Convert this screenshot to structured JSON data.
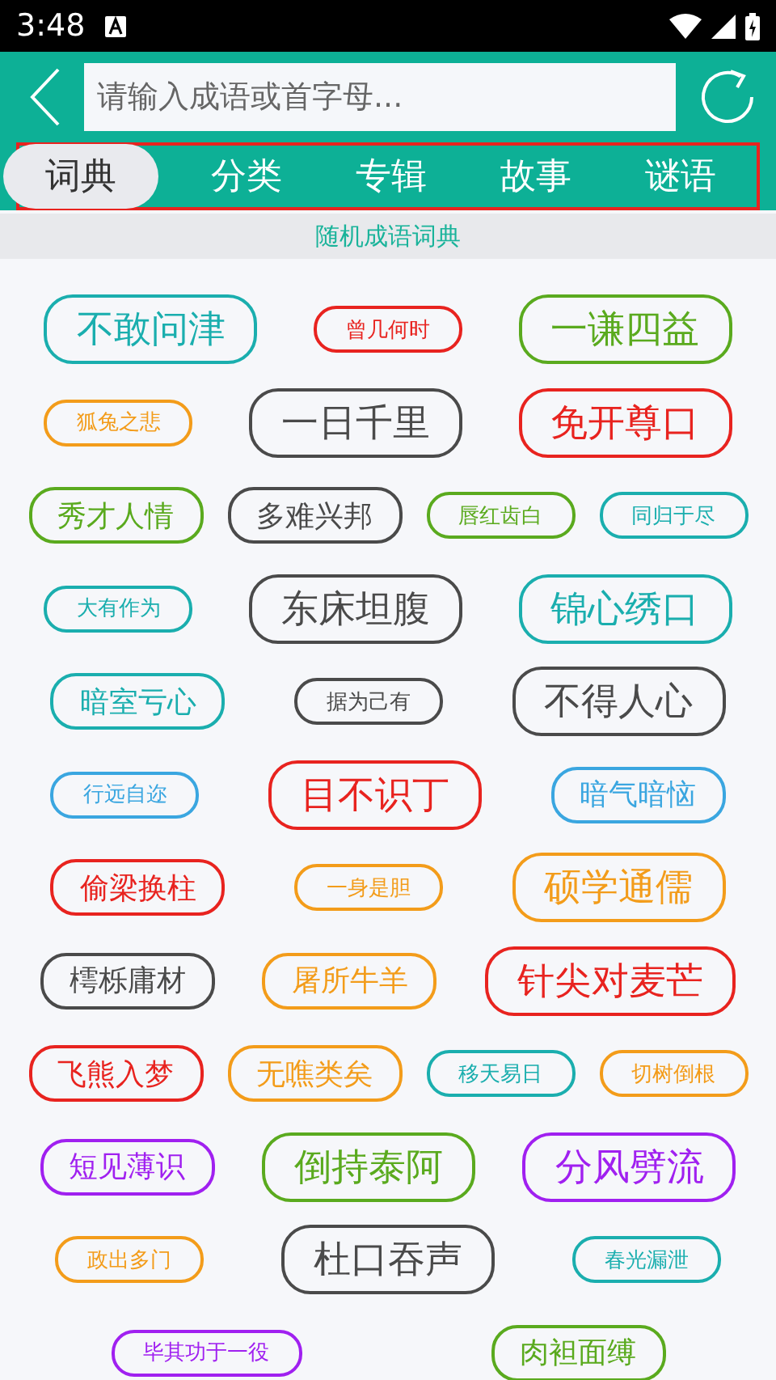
{
  "status_bar": {
    "time": "3:48"
  },
  "search": {
    "placeholder": "请输入成语或首字母..."
  },
  "tabs": [
    {
      "label": "词典",
      "selected": true
    },
    {
      "label": "分类",
      "selected": false
    },
    {
      "label": "专辑",
      "selected": false
    },
    {
      "label": "故事",
      "selected": false
    },
    {
      "label": "谜语",
      "selected": false
    }
  ],
  "section_title": "随机成语词典",
  "tag_rows": [
    [
      {
        "text": "不敢问津",
        "kind": "large",
        "color": "#1aaeae"
      },
      {
        "text": "曾几何时",
        "kind": "small",
        "color": "#e8231f"
      },
      {
        "text": "一谦四益",
        "kind": "large",
        "color": "#5aaa1e"
      }
    ],
    [
      {
        "text": "狐兔之悲",
        "kind": "small",
        "color": "#f39c1a"
      },
      {
        "text": "一日千里",
        "kind": "large",
        "color": "#4a4a4a"
      },
      {
        "text": "免开尊口",
        "kind": "large",
        "color": "#e8231f"
      }
    ],
    [
      {
        "text": "秀才人情",
        "kind": "medium",
        "color": "#5aaa1e"
      },
      {
        "text": "多难兴邦",
        "kind": "medium",
        "color": "#4a4a4a"
      },
      {
        "text": "唇红齿白",
        "kind": "small",
        "color": "#5aaa1e"
      },
      {
        "text": "同归于尽",
        "kind": "small",
        "color": "#1aaeae"
      }
    ],
    [
      {
        "text": "大有作为",
        "kind": "small",
        "color": "#1aaeae"
      },
      {
        "text": "东床坦腹",
        "kind": "large",
        "color": "#4a4a4a"
      },
      {
        "text": "锦心绣口",
        "kind": "large",
        "color": "#1aaeae"
      }
    ],
    [
      {
        "text": "暗室亏心",
        "kind": "medium",
        "color": "#1aaeae"
      },
      {
        "text": "据为己有",
        "kind": "small",
        "color": "#4a4a4a"
      },
      {
        "text": "不得人心",
        "kind": "large",
        "color": "#4a4a4a"
      }
    ],
    [
      {
        "text": "行远自迩",
        "kind": "small",
        "color": "#3aa6e0"
      },
      {
        "text": "目不识丁",
        "kind": "large",
        "color": "#e8231f"
      },
      {
        "text": "暗气暗恼",
        "kind": "medium",
        "color": "#3aa6e0"
      }
    ],
    [
      {
        "text": "偷梁换柱",
        "kind": "medium",
        "color": "#e8231f"
      },
      {
        "text": "一身是胆",
        "kind": "small",
        "color": "#f39c1a"
      },
      {
        "text": "硕学通儒",
        "kind": "large",
        "color": "#f39c1a"
      }
    ],
    [
      {
        "text": "樗栎庸材",
        "kind": "medium",
        "color": "#4a4a4a"
      },
      {
        "text": "屠所牛羊",
        "kind": "medium",
        "color": "#f39c1a"
      },
      {
        "text": "针尖对麦芒",
        "kind": "large",
        "color": "#e8231f"
      }
    ],
    [
      {
        "text": "飞熊入梦",
        "kind": "medium",
        "color": "#e8231f"
      },
      {
        "text": "无噍类矣",
        "kind": "medium",
        "color": "#f39c1a"
      },
      {
        "text": "移天易日",
        "kind": "small",
        "color": "#1aaeae"
      },
      {
        "text": "切树倒根",
        "kind": "small",
        "color": "#f39c1a"
      }
    ],
    [
      {
        "text": "短见薄识",
        "kind": "medium",
        "color": "#a020f0"
      },
      {
        "text": "倒持泰阿",
        "kind": "large",
        "color": "#5aaa1e"
      },
      {
        "text": "分风劈流",
        "kind": "large",
        "color": "#a020f0"
      }
    ],
    [
      {
        "text": "政出多门",
        "kind": "small",
        "color": "#f39c1a"
      },
      {
        "text": "杜口吞声",
        "kind": "large",
        "color": "#4a4a4a"
      },
      {
        "text": "春光漏泄",
        "kind": "small",
        "color": "#1aaeae"
      }
    ],
    [
      {
        "text": "毕其功于一役",
        "kind": "small",
        "color": "#a020f0"
      },
      {
        "text": "肉袒面缚",
        "kind": "medium",
        "color": "#5aaa1e"
      }
    ]
  ]
}
